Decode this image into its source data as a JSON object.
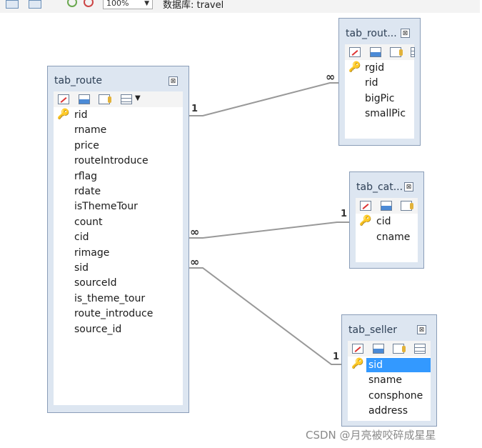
{
  "toolbar": {
    "zoom_value": "100%",
    "database_label": "数据库: travel"
  },
  "tables": {
    "tab_route": {
      "title": "tab_route",
      "fields": [
        "rid",
        "rname",
        "price",
        "routeIntroduce",
        "rflag",
        "rdate",
        "isThemeTour",
        "count",
        "cid",
        "rimage",
        "sid",
        "sourceId",
        "is_theme_tour",
        "route_introduce",
        "source_id"
      ]
    },
    "tab_route_img": {
      "title": "tab_rout...",
      "fields": [
        "rgid",
        "rid",
        "bigPic",
        "smallPic"
      ]
    },
    "tab_category": {
      "title": "tab_cat...",
      "fields": [
        "cid",
        "cname"
      ]
    },
    "tab_seller": {
      "title": "tab_seller",
      "fields": [
        "sid",
        "sname",
        "consphone",
        "address"
      ]
    }
  },
  "relations": [
    {
      "from": "tab_route",
      "to": "tab_route_img",
      "from_card": "1",
      "to_card": "∞"
    },
    {
      "from": "tab_route",
      "to": "tab_category",
      "from_card": "∞",
      "to_card": "1"
    },
    {
      "from": "tab_route",
      "to": "tab_seller",
      "from_card": "∞",
      "to_card": "1"
    }
  ],
  "watermark": "CSDN @月亮被咬碎成星星"
}
